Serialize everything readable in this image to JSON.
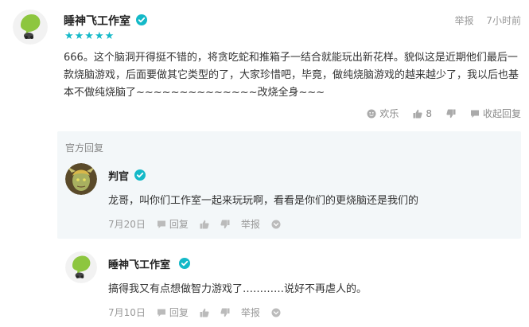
{
  "comment": {
    "author": "睡神飞工作室",
    "stars": "★★★★★",
    "report_label": "举报",
    "time": "7小时前",
    "content": "666。这个脑洞开得挺不错的，将贪吃蛇和推箱子一结合就能玩出新花样。貌似这是近期他们最后一款烧脑游戏，后面要做其它类型的了，大家珍惜吧，毕竟，做纯烧脑游戏的越来越少了，我以后也基本不做纯烧脑了~~~~~~~~~~~~~~改烧全身~~~",
    "actions": {
      "happy_label": "欢乐",
      "like_count": "8",
      "collapse_label": "收起回复"
    }
  },
  "official_section": {
    "title": "官方回复"
  },
  "replies": [
    {
      "author": "判官",
      "text": "龙哥，叫你们工作室一起来玩玩啊，看看是你们的更烧脑还是我们的",
      "date": "7月20日",
      "reply_label": "回复",
      "report_label": "举报"
    },
    {
      "author": "睡神飞工作室",
      "text": "搞得我又有点想做智力游戏了…………说好不再虐人的。",
      "date": "7月10日",
      "reply_label": "回复",
      "report_label": "举报"
    }
  ],
  "colors": {
    "accent": "#14b9c8",
    "logo_green": "#8dc63f",
    "official_bg": "#f3f7f9"
  }
}
